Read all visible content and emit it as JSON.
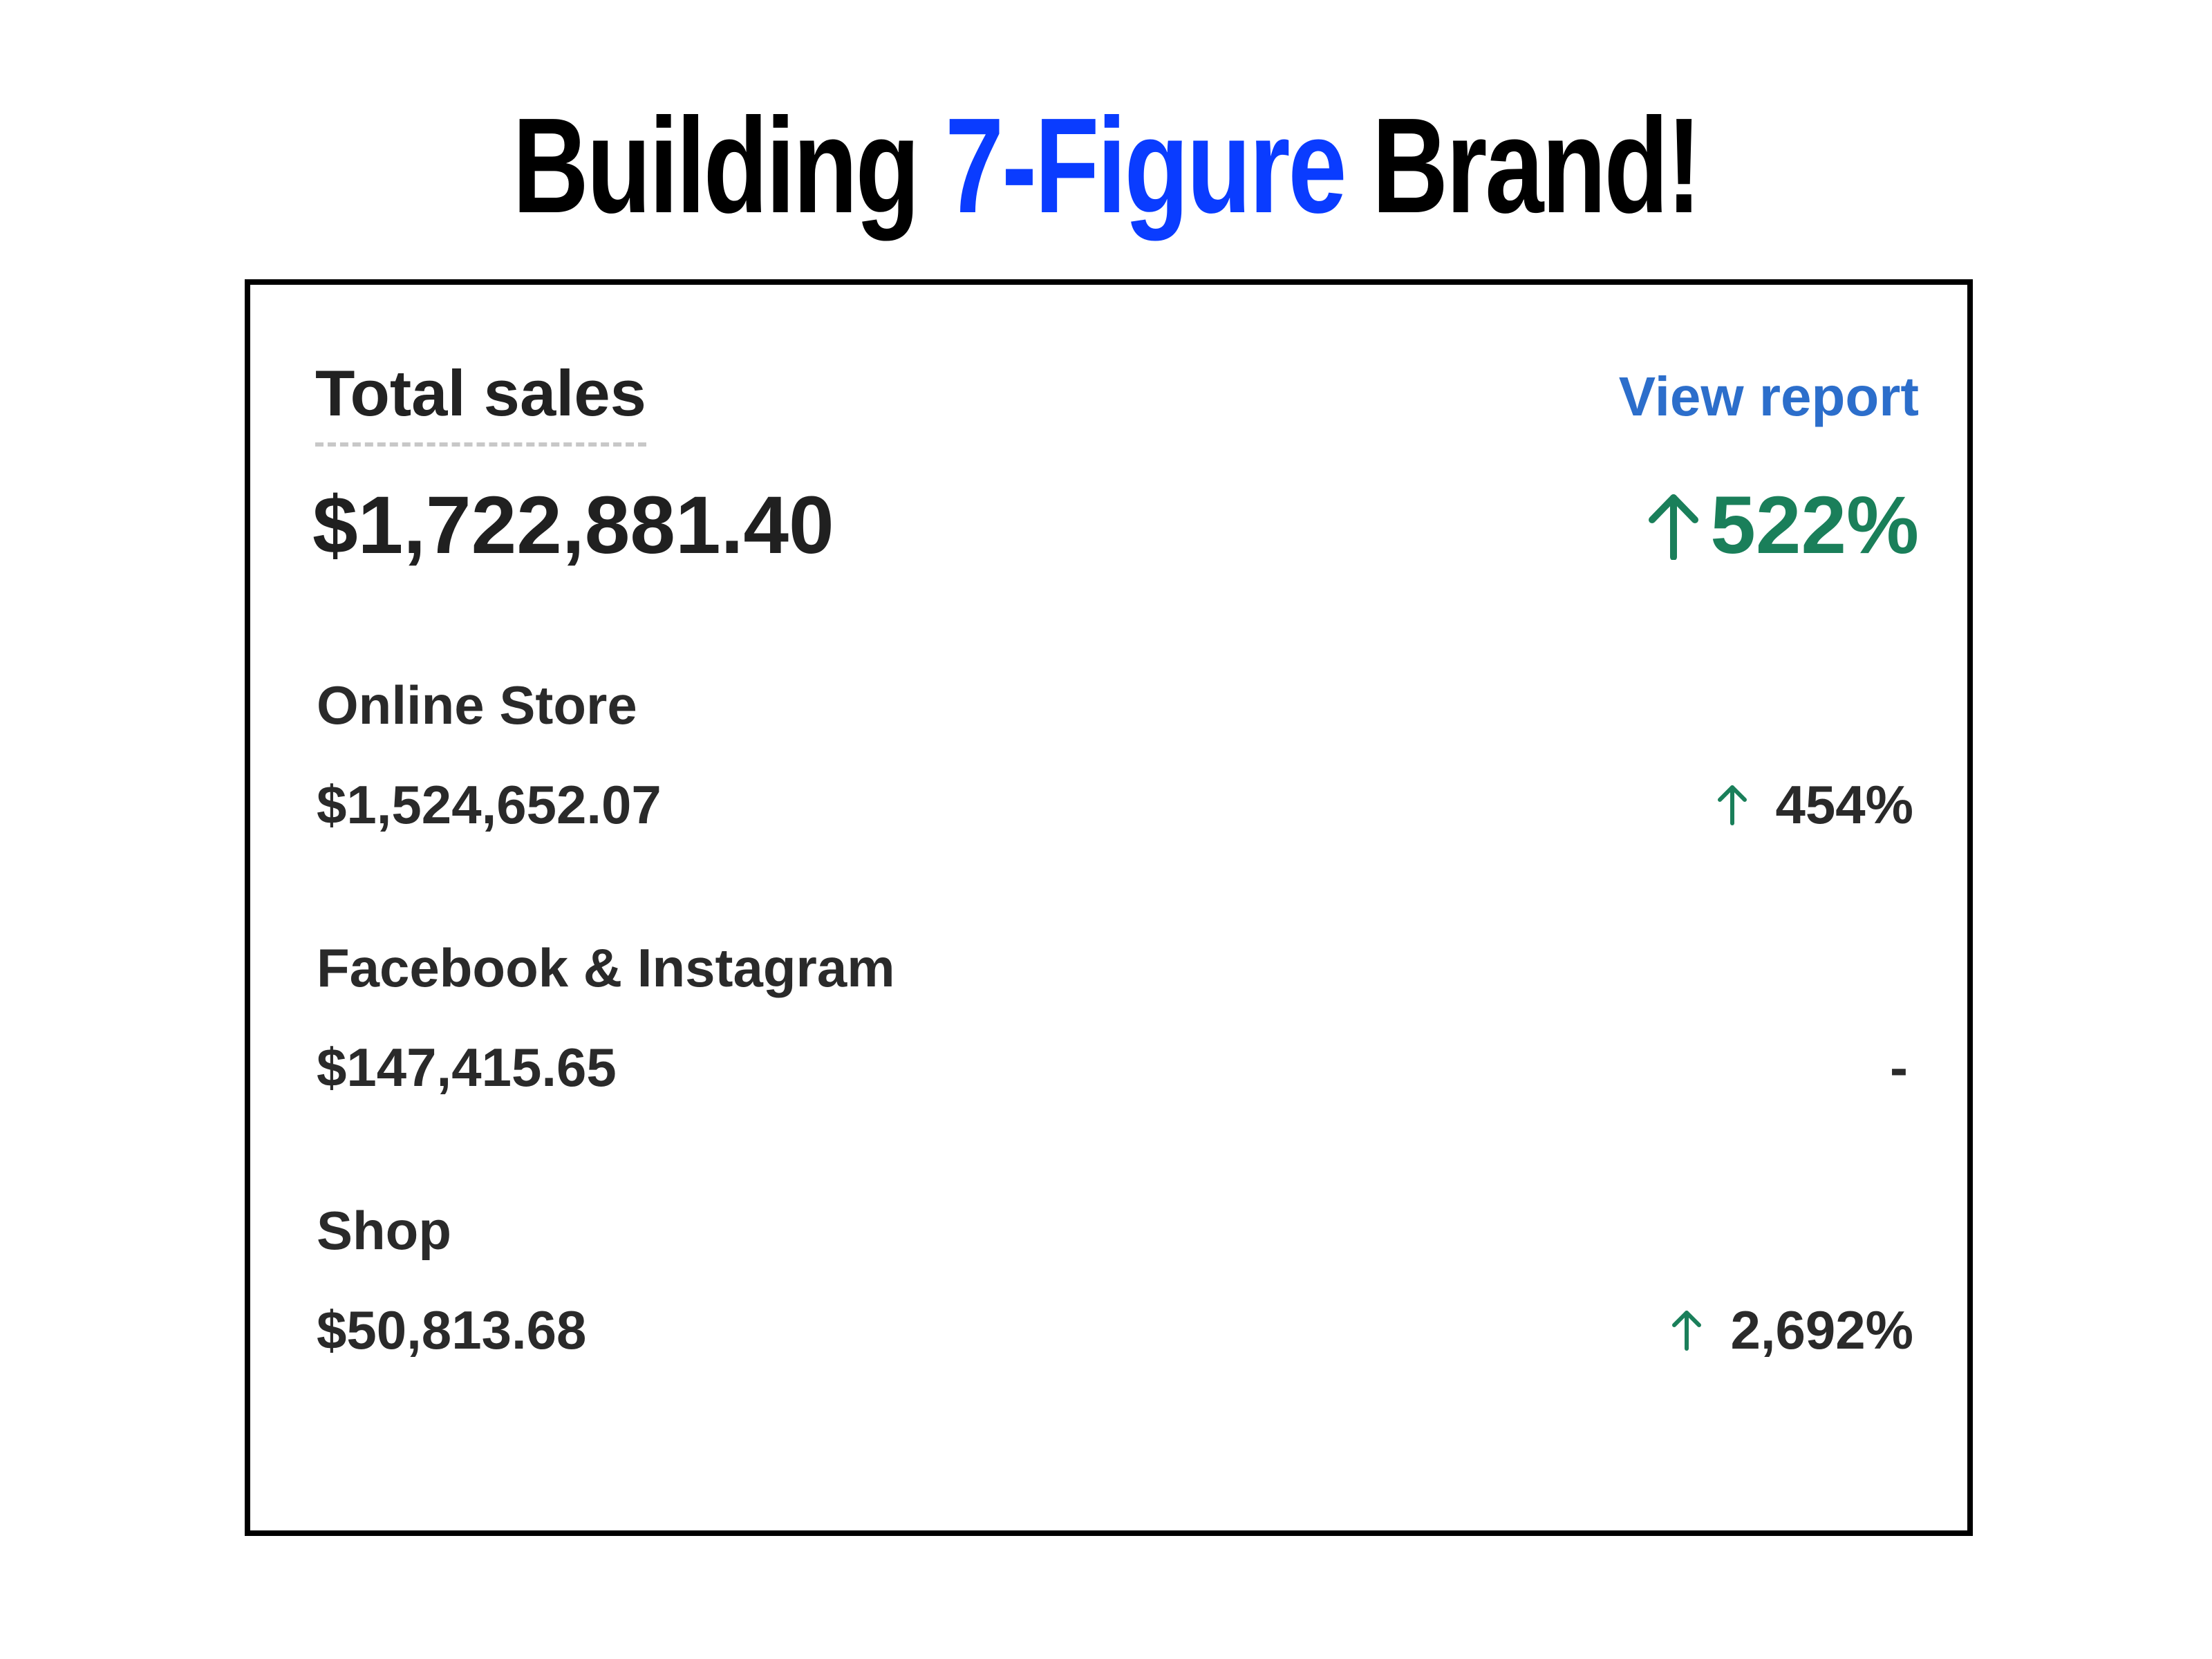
{
  "headline": {
    "prefix": "Building",
    "accent": "7-Figure",
    "suffix": "Brand!",
    "accent_color": "#0a3cff"
  },
  "card": {
    "title": "Total sales",
    "view_report": "View report",
    "total_value": "$1,722,881.40",
    "total_change": "522%",
    "change_icon": "arrow-up-icon",
    "positive_color": "#1a7f5a",
    "link_color": "#2c6ecb",
    "channels": [
      {
        "name": "Online Store",
        "value": "$1,524,652.07",
        "change": "454%"
      },
      {
        "name": "Facebook & Instagram",
        "value": "$147,415.65",
        "change": "-"
      },
      {
        "name": "Shop",
        "value": "$50,813.68",
        "change": "2,692%"
      }
    ]
  }
}
